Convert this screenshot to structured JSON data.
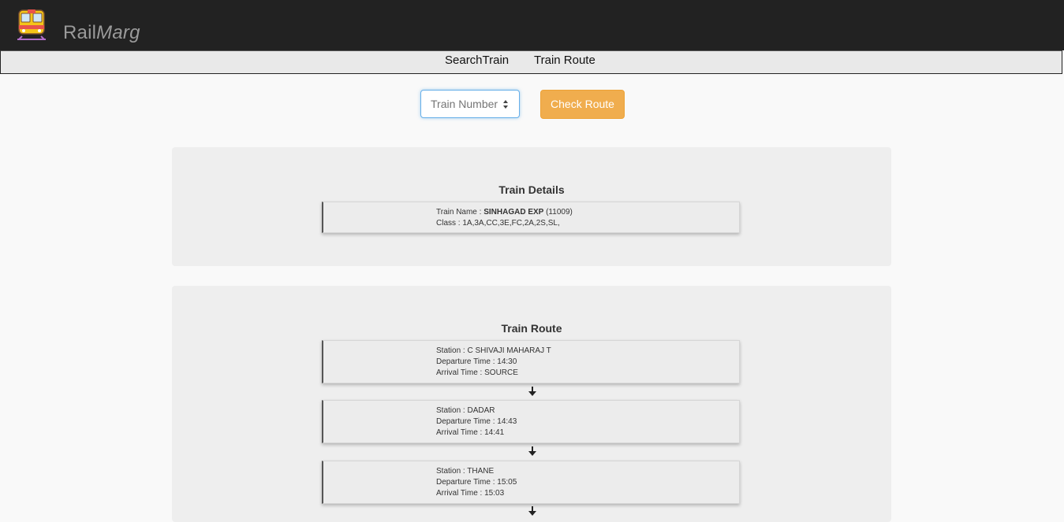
{
  "header": {
    "brand_main": "Rail",
    "brand_italic": "Marg",
    "logo_icon": "train-icon"
  },
  "nav": {
    "items": [
      {
        "label": "SearchTrain"
      },
      {
        "label": "Train Route"
      }
    ]
  },
  "search": {
    "placeholder": "Train Number",
    "button_label": "Check Route",
    "button_color": "#f0ad4e"
  },
  "details": {
    "title": "Train Details",
    "name_label": "Train Name : ",
    "name_value": "SINHAGAD EXP",
    "number_value": " (11009)",
    "class_label": "Class : ",
    "class_value": " 1A,3A,CC,3E,FC,2A,2S,SL,"
  },
  "route": {
    "title": "Train Route",
    "stops": [
      {
        "station": "Station : C SHIVAJI MAHARAJ T",
        "departure": "Departure Time : 14:30",
        "arrival": "Arrival Time : SOURCE"
      },
      {
        "station": "Station : DADAR",
        "departure": "Departure Time : 14:43",
        "arrival": "Arrival Time : 14:41"
      },
      {
        "station": "Station : THANE",
        "departure": "Departure Time : 15:05",
        "arrival": "Arrival Time : 15:03"
      }
    ]
  }
}
